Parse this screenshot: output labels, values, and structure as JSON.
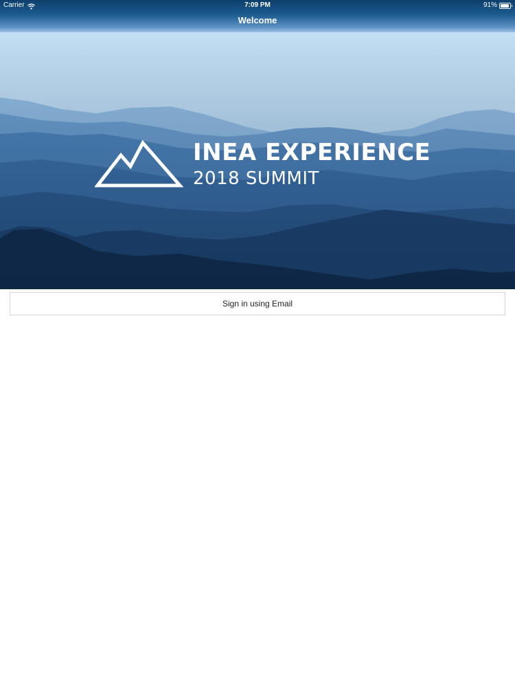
{
  "status_bar": {
    "carrier": "Carrier",
    "time": "7:09 PM",
    "battery": "91%",
    "battery_level": 0.91
  },
  "nav": {
    "title": "Welcome"
  },
  "hero": {
    "title_line1": "INEA EXPERIENCE",
    "title_line2": "2018 SUMMIT",
    "logo_icon": "mountain-icon"
  },
  "actions": {
    "signin_label": "Sign in using Email"
  },
  "colors": {
    "bar_dark": "#0d3f6c",
    "sky": "#c9e2f5",
    "mountain_dark": "#102a4a",
    "button_border": "#d3d3d3"
  }
}
